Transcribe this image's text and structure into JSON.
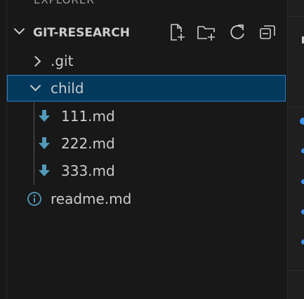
{
  "explorer": {
    "title": "EXPLORER"
  },
  "section": {
    "label": "GIT-RESEARCH",
    "actions": [
      {
        "name": "new-file-icon"
      },
      {
        "name": "new-folder-icon"
      },
      {
        "name": "refresh-icon"
      },
      {
        "name": "collapse-all-icon"
      }
    ]
  },
  "tree": {
    "git_folder": ".git",
    "child_folder": "child",
    "files": [
      "111.md",
      "222.md",
      "333.md"
    ],
    "readme": "readme.md"
  },
  "colors": {
    "background": "#181818",
    "selection": "#04395e",
    "selection_border": "#2f7ec8",
    "text": "#cccccc",
    "markdown_icon": "#519aba",
    "info_icon": "#519aba"
  }
}
